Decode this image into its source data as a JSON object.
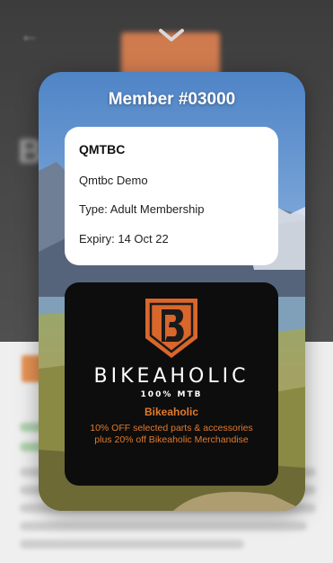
{
  "card": {
    "title": "Member #03000",
    "club_code": "QMTBC",
    "member_name": "Qmtbc Demo",
    "type": "Type: Adult Membership",
    "expiry": "Expiry: 14 Oct 22"
  },
  "sponsor": {
    "wordmark": "BIKEAHOLIC",
    "tagline": "100% MTB",
    "name": "Bikeaholic",
    "offer": "10% OFF selected parts & accessories plus 20% off Bikeaholic Merchandise",
    "accent_color": "#e07a2e"
  },
  "icons": {
    "dismiss": "chevron-down-icon",
    "back": "back-arrow-icon",
    "sponsor_logo": "bikeaholic-shield-logo"
  }
}
